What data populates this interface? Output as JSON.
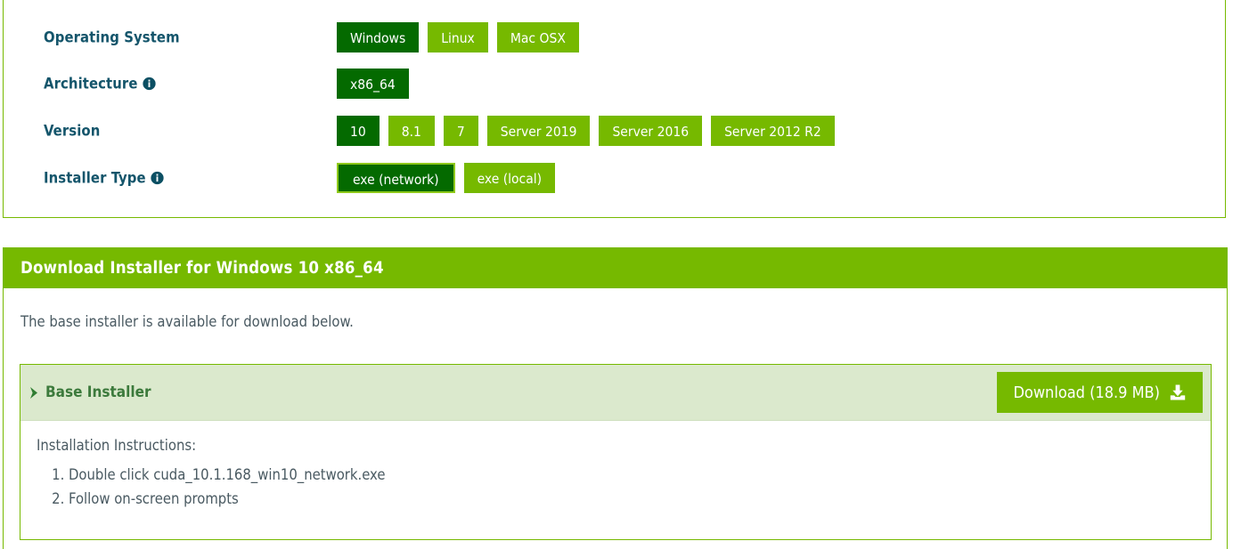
{
  "selector": {
    "rows": [
      {
        "label": "Operating System",
        "has_info": false,
        "options": [
          {
            "label": "Windows",
            "state": "selected"
          },
          {
            "label": "Linux",
            "state": "normal"
          },
          {
            "label": "Mac OSX",
            "state": "normal"
          }
        ]
      },
      {
        "label": "Architecture",
        "has_info": true,
        "options": [
          {
            "label": "x86_64",
            "state": "selected"
          }
        ]
      },
      {
        "label": "Version",
        "has_info": false,
        "options": [
          {
            "label": "10",
            "state": "selected"
          },
          {
            "label": "8.1",
            "state": "normal"
          },
          {
            "label": "7",
            "state": "normal"
          },
          {
            "label": "Server 2019",
            "state": "normal"
          },
          {
            "label": "Server 2016",
            "state": "normal"
          },
          {
            "label": "Server 2012 R2",
            "state": "normal"
          }
        ]
      },
      {
        "label": "Installer Type",
        "has_info": true,
        "options": [
          {
            "label": "exe (network)",
            "state": "focused"
          },
          {
            "label": "exe (local)",
            "state": "normal"
          }
        ]
      }
    ],
    "info_icon_name": "info-icon"
  },
  "download": {
    "header_title": "Download Installer for Windows 10 x86_64",
    "intro": "The base installer is available for download below.",
    "installer": {
      "title": "Base Installer",
      "chevron_icon": "chevron-right-icon",
      "download_label": "Download (18.9 MB)",
      "download_icon": "download-icon",
      "instructions_heading": "Installation Instructions:",
      "instructions": [
        "Double click cuda_10.1.168_win10_network.exe",
        "Follow on-screen prompts"
      ]
    }
  },
  "colors": {
    "nvidia_green": "#76b900",
    "dark_green": "#046a00",
    "focus_border": "#8fc91b",
    "label_text": "#14556b",
    "band_bg": "#dbe9cd",
    "installer_title": "#3c7a3c",
    "body_text": "#4a5a62"
  }
}
